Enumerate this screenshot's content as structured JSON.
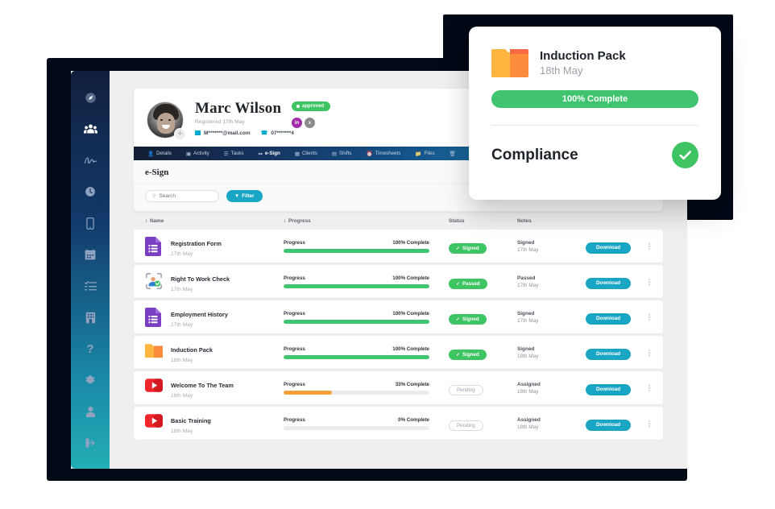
{
  "sidebar": {
    "items": [
      {
        "icon": "compass-icon",
        "label": "Dashboard",
        "active": false
      },
      {
        "icon": "users-icon",
        "label": "People",
        "active": true
      },
      {
        "icon": "signature-icon",
        "label": "e-Sign",
        "active": false
      },
      {
        "icon": "clock-icon",
        "label": "Time",
        "active": false
      },
      {
        "icon": "mobile-icon",
        "label": "Mobile",
        "active": false
      },
      {
        "icon": "calendar-icon",
        "label": "Calendar",
        "active": false
      },
      {
        "icon": "list-icon",
        "label": "Tasks",
        "active": false
      },
      {
        "icon": "building-icon",
        "label": "Clients",
        "active": false
      },
      {
        "icon": "question-icon",
        "label": "Help",
        "active": false
      },
      {
        "icon": "gear-icon",
        "label": "Settings",
        "active": false
      },
      {
        "icon": "person-icon",
        "label": "Account",
        "active": false
      },
      {
        "icon": "logout-icon",
        "label": "Log out",
        "active": false
      }
    ]
  },
  "profile": {
    "name": "Marc Wilson",
    "registered": "Registered 17th May",
    "email": "M*******@mail.com",
    "phone": "07*******4",
    "status_badge": "approved",
    "mini_badges": [
      "in",
      "x"
    ]
  },
  "tabs": [
    {
      "label": "Details",
      "icon": "person-icon",
      "active": false
    },
    {
      "label": "Activity",
      "icon": "chart-icon",
      "active": false
    },
    {
      "label": "Tasks",
      "icon": "list-icon",
      "active": false
    },
    {
      "label": "e-Sign",
      "icon": "signature-icon",
      "active": true
    },
    {
      "label": "Clients",
      "icon": "building-icon",
      "active": false
    },
    {
      "label": "Shifts",
      "icon": "clipboard-icon",
      "active": false
    },
    {
      "label": "Timesheets",
      "icon": "clock-icon",
      "active": false
    },
    {
      "label": "Files",
      "icon": "folder-icon",
      "active": false
    },
    {
      "label": "",
      "icon": "trash-icon",
      "active": false
    }
  ],
  "panel": {
    "title": "e-Sign",
    "search_placeholder": "Search",
    "search_value": "",
    "filter_label": "Filter"
  },
  "table": {
    "headers": {
      "name": "Name",
      "progress": "Progress",
      "status": "Status",
      "notes": "Notes"
    },
    "download_label": "Download",
    "progress_label": "Progress",
    "rows": [
      {
        "icon": "google-form-icon",
        "name": "Registration Form",
        "date": "17th May",
        "progress_label": "Progress",
        "progress_text": "100% Complete",
        "progress_pct": 100,
        "bar_color": "#3fc46f",
        "status": "Signed",
        "status_type": "green",
        "note_title": "Signed",
        "note_date": "17th May",
        "download": "Download"
      },
      {
        "icon": "id-check-icon",
        "name": "Right To Work Check",
        "date": "17th May",
        "progress_label": "Progress",
        "progress_text": "100% Complete",
        "progress_pct": 100,
        "bar_color": "#3fc46f",
        "status": "Passed",
        "status_type": "green",
        "note_title": "Passed",
        "note_date": "17th May",
        "download": "Download"
      },
      {
        "icon": "google-form-icon",
        "name": "Employment History",
        "date": "17th May",
        "progress_label": "Progress",
        "progress_text": "100% Complete",
        "progress_pct": 100,
        "bar_color": "#3fc46f",
        "status": "Signed",
        "status_type": "green",
        "note_title": "Signed",
        "note_date": "17th May",
        "download": "Download"
      },
      {
        "icon": "folder-icon",
        "name": "Induction Pack",
        "date": "18th May",
        "progress_label": "Progress",
        "progress_text": "100% Complete",
        "progress_pct": 100,
        "bar_color": "#3fc46f",
        "status": "Signed",
        "status_type": "green",
        "note_title": "Signed",
        "note_date": "18th May",
        "download": "Download"
      },
      {
        "icon": "youtube-icon",
        "name": "Welcome To The Team",
        "date": "18th May",
        "progress_label": "Progress",
        "progress_text": "33% Complete",
        "progress_pct": 33,
        "bar_color": "#f2a13b",
        "status": "Pending",
        "status_type": "ghost",
        "note_title": "Assigned",
        "note_date": "18th May",
        "download": "Download"
      },
      {
        "icon": "youtube-icon",
        "name": "Basic Training",
        "date": "18th May",
        "progress_label": "Progress",
        "progress_text": "0% Complete",
        "progress_pct": 0,
        "bar_color": "#f2a13b",
        "status": "Pending",
        "status_type": "ghost",
        "note_title": "Assigned",
        "note_date": "18th May",
        "download": "Download"
      }
    ]
  },
  "popup": {
    "icon": "folder-icon",
    "title": "Induction Pack",
    "date": "18th May",
    "progress_text": "100% Complete",
    "compliance_label": "Compliance",
    "compliance_state": "check-icon"
  },
  "colors": {
    "accent_teal": "#19a5c4",
    "green": "#3fc463",
    "orange": "#f2a13b",
    "dark_frame": "#020916"
  }
}
